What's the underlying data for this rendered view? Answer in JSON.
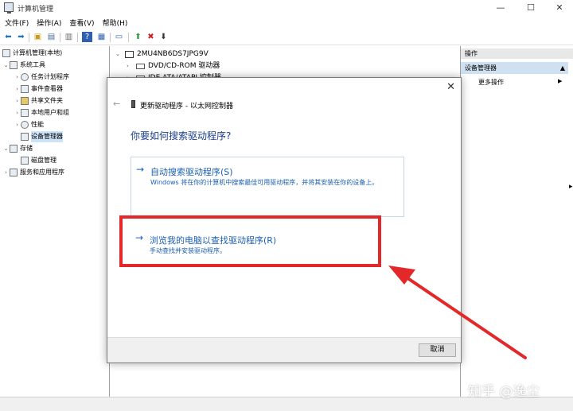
{
  "window": {
    "title": "计算机管理",
    "minimize": "—",
    "maximize": "☐",
    "close": "✕"
  },
  "menu": {
    "items": [
      "文件(F)",
      "操作(A)",
      "查看(V)",
      "帮助(H)"
    ]
  },
  "toolbar": {
    "icons": [
      "back-icon",
      "forward-icon",
      "up-folder-icon",
      "properties-icon",
      "export-icon",
      "help-icon",
      "show-hide-tree-icon",
      "monitor-icon",
      "update-driver-icon",
      "uninstall-icon",
      "scan-icon"
    ]
  },
  "tree": {
    "root": "计算机管理(本地)",
    "system_tools": "系统工具",
    "task_scheduler": "任务计划程序",
    "event_viewer": "事件查看器",
    "shared_folders": "共享文件夹",
    "local_users": "本地用户和组",
    "performance": "性能",
    "device_manager": "设备管理器",
    "storage": "存储",
    "disk_management": "磁盘管理",
    "services_apps": "服务和应用程序"
  },
  "devices": {
    "computer": "2MU4NB6DS7JPG9V",
    "dvd": "DVD/CD-ROM 驱动器",
    "ide": "IDE ATA/ATAPI 控制器"
  },
  "actions": {
    "header": "操作",
    "device_manager": "设备管理器",
    "more_actions": "更多操作"
  },
  "dialog": {
    "title": "更新驱动程序 - 以太网控制器",
    "question": "你要如何搜索驱动程序?",
    "auto_title": "自动搜索驱动程序(S)",
    "auto_desc": "Windows 将在你的计算机中搜索最佳可用驱动程序，并将其安装在你的设备上。",
    "browse_title": "浏览我的电脑以查找驱动程序(R)",
    "browse_desc": "手动查找并安装驱动程序。",
    "cancel": "取消",
    "close": "✕",
    "back": "←"
  },
  "colors": {
    "link_blue": "#1a5fb4",
    "question_blue": "#1a3e8c",
    "annotation_red": "#e3282a"
  },
  "watermark": "知乎 @逸尘"
}
